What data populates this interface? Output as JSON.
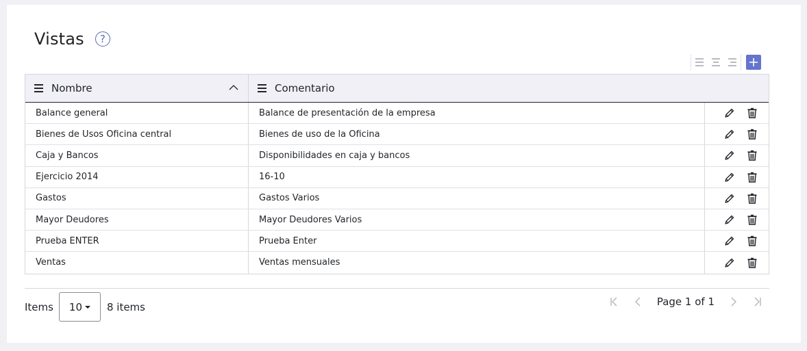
{
  "page": {
    "title": "Vistas",
    "help_glyph": "?"
  },
  "toolbar": {
    "icons": [
      "align-left-icon",
      "align-center-icon",
      "align-right-icon"
    ],
    "add_icon": "plus-icon",
    "accent_color": "#6574cd"
  },
  "table": {
    "columns": [
      {
        "label": "Nombre",
        "sort": "ascending"
      },
      {
        "label": "Comentario"
      }
    ],
    "rows": [
      {
        "nombre": "Balance general",
        "comentario": "Balance de presentación de la empresa"
      },
      {
        "nombre": "Bienes de Usos Oficina central",
        "comentario": "Bienes de uso de la Oficina"
      },
      {
        "nombre": "Caja y Bancos",
        "comentario": "Disponibilidades en caja y bancos"
      },
      {
        "nombre": "Ejercicio 2014",
        "comentario": "16-10"
      },
      {
        "nombre": "Gastos",
        "comentario": "Gastos Varios"
      },
      {
        "nombre": "Mayor Deudores",
        "comentario": "Mayor Deudores Varios"
      },
      {
        "nombre": "Prueba ENTER",
        "comentario": "Prueba Enter"
      },
      {
        "nombre": "Ventas",
        "comentario": "Ventas mensuales"
      }
    ],
    "row_actions": [
      "edit-icon",
      "trash-icon"
    ]
  },
  "pager": {
    "items_label": "Items",
    "page_size": "10",
    "count_label": "8 items",
    "page_info": "Page 1 of 1"
  }
}
